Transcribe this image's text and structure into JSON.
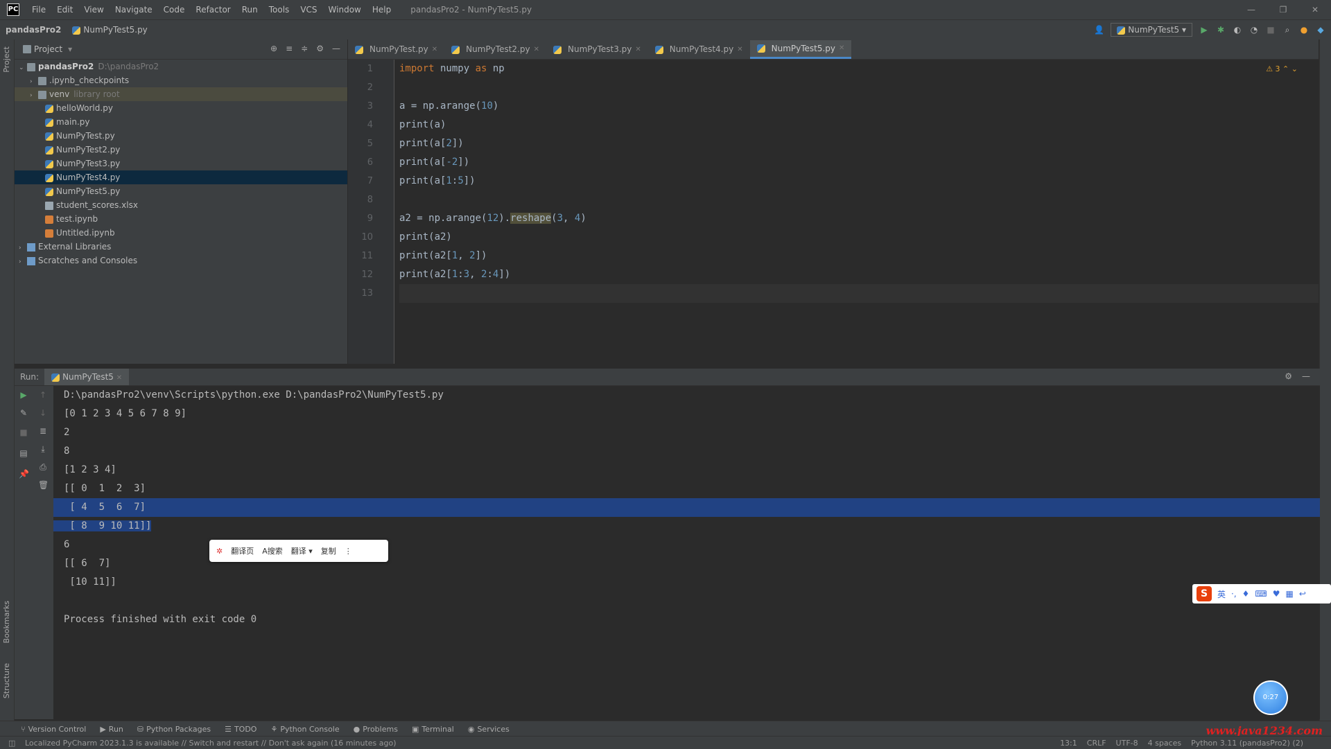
{
  "menubar": {
    "items": [
      "File",
      "Edit",
      "View",
      "Navigate",
      "Code",
      "Refactor",
      "Run",
      "Tools",
      "VCS",
      "Window",
      "Help"
    ],
    "window_title": "pandasPro2 - NumPyTest5.py"
  },
  "navbar": {
    "project": "pandasPro2",
    "file": "NumPyTest5.py",
    "run_config": "NumPyTest5"
  },
  "project_panel": {
    "title": "Project",
    "root_name": "pandasPro2",
    "root_path": "D:\\pandasPro2",
    "items": [
      {
        "label": "ipynb_checkpoints",
        "prefix": ".",
        "type": "folder",
        "indent": 1,
        "chev": true
      },
      {
        "label": "venv",
        "extra": "library root",
        "type": "folder",
        "indent": 1,
        "chev": true
      },
      {
        "label": "helloWorld.py",
        "type": "py",
        "indent": 2
      },
      {
        "label": "main.py",
        "type": "py",
        "indent": 2
      },
      {
        "label": "NumPyTest.py",
        "type": "py",
        "indent": 2
      },
      {
        "label": "NumPyTest2.py",
        "type": "py",
        "indent": 2
      },
      {
        "label": "NumPyTest3.py",
        "type": "py",
        "indent": 2
      },
      {
        "label": "NumPyTest4.py",
        "type": "py",
        "indent": 2
      },
      {
        "label": "NumPyTest5.py",
        "type": "py",
        "indent": 2
      },
      {
        "label": "student_scores.xlsx",
        "type": "xls",
        "indent": 2
      },
      {
        "label": "test.ipynb",
        "type": "nb",
        "indent": 2
      },
      {
        "label": "Untitled.ipynb",
        "type": "nb",
        "indent": 2
      },
      {
        "label": "External Libraries",
        "type": "lib",
        "indent": 0,
        "chev": true
      },
      {
        "label": "Scratches and Consoles",
        "type": "lib",
        "indent": 0,
        "chev": true
      }
    ]
  },
  "editor": {
    "tabs": [
      "NumPyTest.py",
      "NumPyTest2.py",
      "NumPyTest3.py",
      "NumPyTest4.py",
      "NumPyTest5.py"
    ],
    "active_tab": "NumPyTest5.py",
    "warnings": "⚠ 3",
    "line_numbers": [
      "1",
      "2",
      "3",
      "4",
      "5",
      "6",
      "7",
      "8",
      "9",
      "10",
      "11",
      "12",
      "13"
    ]
  },
  "run_panel": {
    "label": "Run:",
    "tab": "NumPyTest5",
    "output": [
      "D:\\pandasPro2\\venv\\Scripts\\python.exe D:\\pandasPro2\\NumPyTest5.py",
      "[0 1 2 3 4 5 6 7 8 9]",
      "2",
      "8",
      "[1 2 3 4]",
      "[[ 0  1  2  3]",
      " [ 4  5  6  7]",
      " [ 8  9 10 11]]",
      "6",
      "[[ 6  7]",
      " [10 11]]",
      "",
      "Process finished with exit code 0"
    ]
  },
  "popup": {
    "items": [
      "翻译页",
      "A搜索",
      "翻译 ▾",
      "复制",
      "⋮"
    ]
  },
  "ime": {
    "logo": "S",
    "items": [
      "英",
      "·,",
      "♦",
      "⌨",
      "♥",
      "▦",
      "↩"
    ]
  },
  "ball": {
    "label": "0:27"
  },
  "toolbar": {
    "items": [
      "Version Control",
      "Run",
      "Python Packages",
      "TODO",
      "Python Console",
      "Problems",
      "Terminal",
      "Services"
    ]
  },
  "status": {
    "message": "Localized PyCharm 2023.1.3 is available // Switch and restart // Don't ask again (16 minutes ago)",
    "position": "13:1",
    "line_sep": "CRLF",
    "encoding": "UTF-8",
    "indent": "4 spaces",
    "interpreter": "Python 3.11 (pandasPro2) (2)"
  },
  "watermark": "www.java1234.com"
}
